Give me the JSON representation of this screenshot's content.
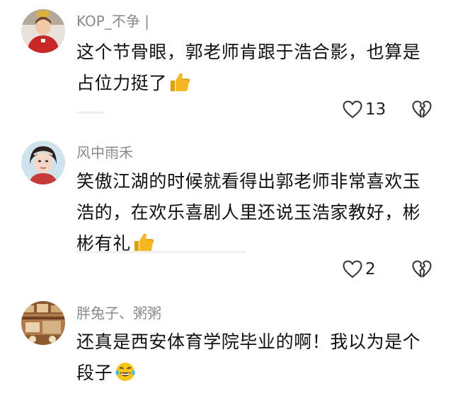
{
  "comments": [
    {
      "username": "KOP_不争 |",
      "text": "这个节骨眼，郭老师肯跟于浩合影，也算是占位力挺了",
      "emoji": "thumbs-up",
      "likes": "13"
    },
    {
      "username": "风中雨禾",
      "text": "笑傲江湖的时候就看得出郭老师非常喜欢玉浩的，在欢乐喜剧人里还说玉浩家教好，彬彬有礼",
      "emoji": "thumbs-up",
      "likes": "2"
    },
    {
      "username": "胖兔子、粥粥",
      "text": "还真是西安体育学院毕业的啊！我以为是个段子",
      "emoji": "laughing-tears"
    }
  ],
  "colors": {
    "username": "#8a8a8a",
    "text": "#111111",
    "icon": "#333333",
    "thumb": "#f5b822",
    "avatar1": "#c62828",
    "avatar2_bg": "#cfe3ee",
    "avatar3_bg": "#b07a4a"
  }
}
